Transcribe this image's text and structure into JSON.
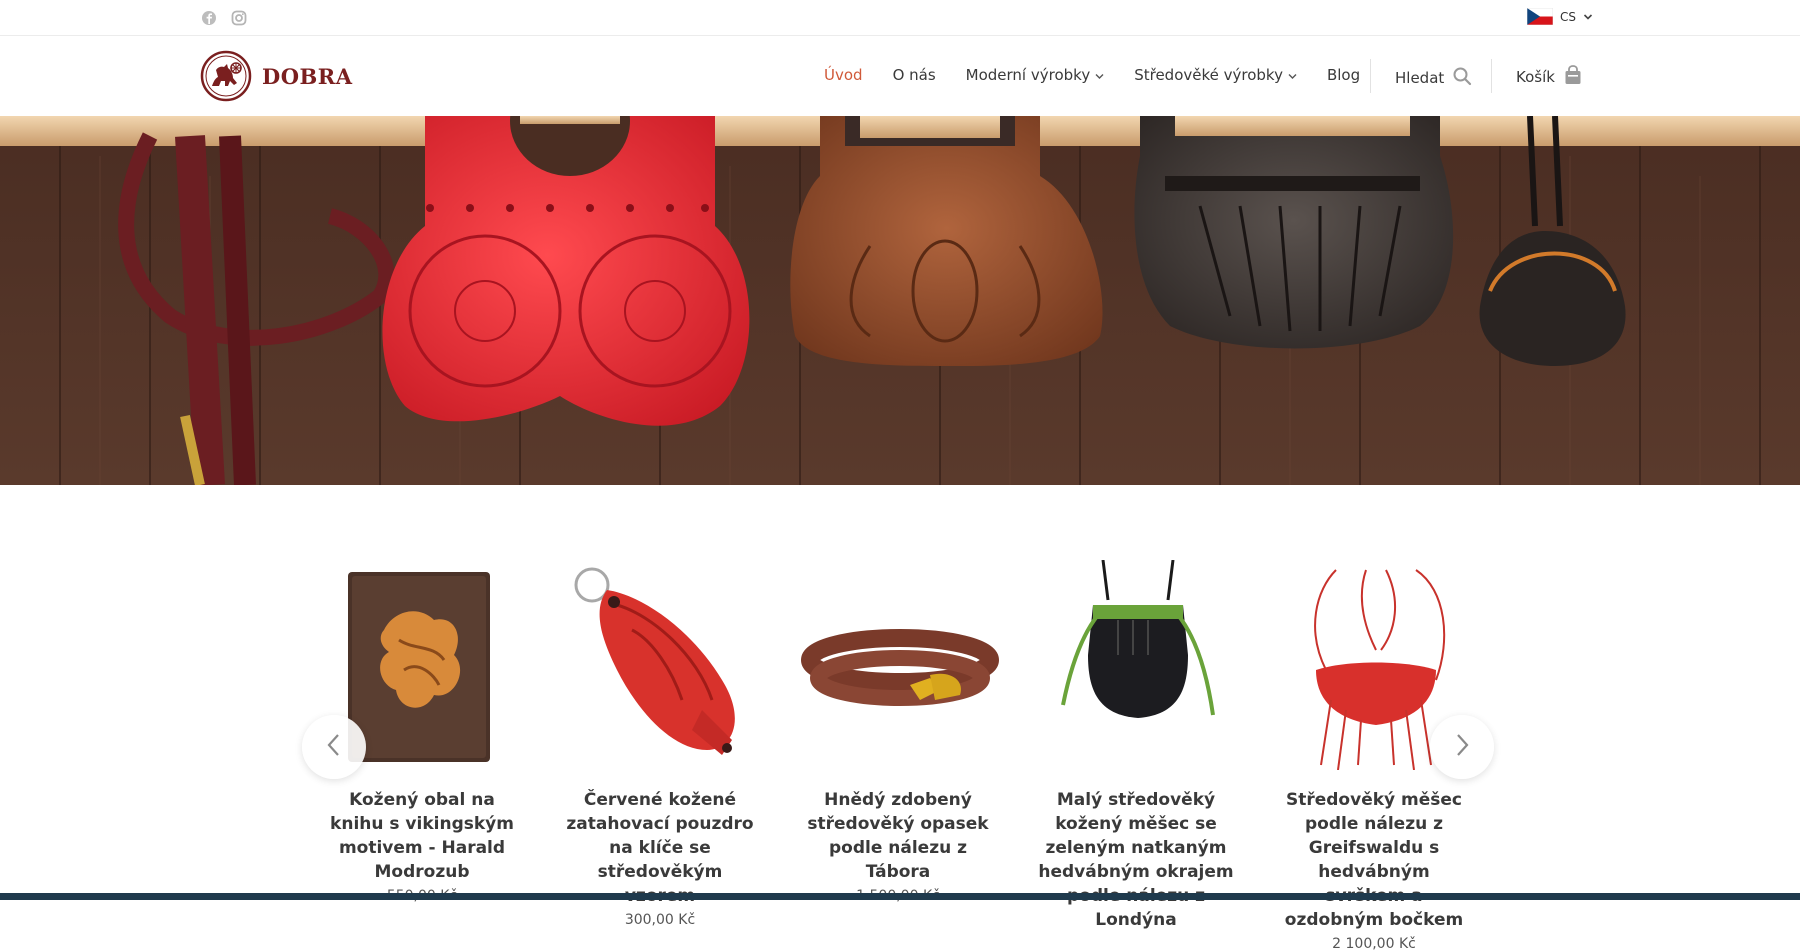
{
  "topbar": {
    "social": [
      {
        "icon": "facebook-icon"
      },
      {
        "icon": "instagram-icon"
      }
    ],
    "language": {
      "code": "CS",
      "flag": "czech-flag-icon"
    }
  },
  "header": {
    "logo_text": "DOBRA",
    "nav": [
      {
        "label": "Úvod",
        "active": true
      },
      {
        "label": "O nás"
      },
      {
        "label": "Moderní výrobky",
        "dropdown": true
      },
      {
        "label": "Středověké výrobky",
        "dropdown": true
      },
      {
        "label": "Blog"
      }
    ],
    "search_label": "Hledat",
    "cart_label": "Košík"
  },
  "colors": {
    "accent": "#d05a3a",
    "brand": "#7a1f1f",
    "text": "#3a3a3a"
  },
  "products": [
    {
      "title": "Kožený obal na knihu s vikingským motivem - Harald Modrozub",
      "price": "550,00 Kč"
    },
    {
      "title": "Červené kožené zatahovací pouzdro na klíče se středověkým vzorem",
      "price": "300,00 Kč"
    },
    {
      "title": "Hnědý zdobený středověký opasek podle nálezu z Tábora",
      "price": "1 500,00 Kč"
    },
    {
      "title": "Malý středověký kožený měšec se zeleným natkaným hedvábným okrajem podle nálezu z Londýna",
      "price": ""
    },
    {
      "title": "Středověký měšec podle nálezu z Greifswaldu s hedvábným svrškem a ozdobným bočkem",
      "price": "2 100,00 Kč"
    }
  ]
}
